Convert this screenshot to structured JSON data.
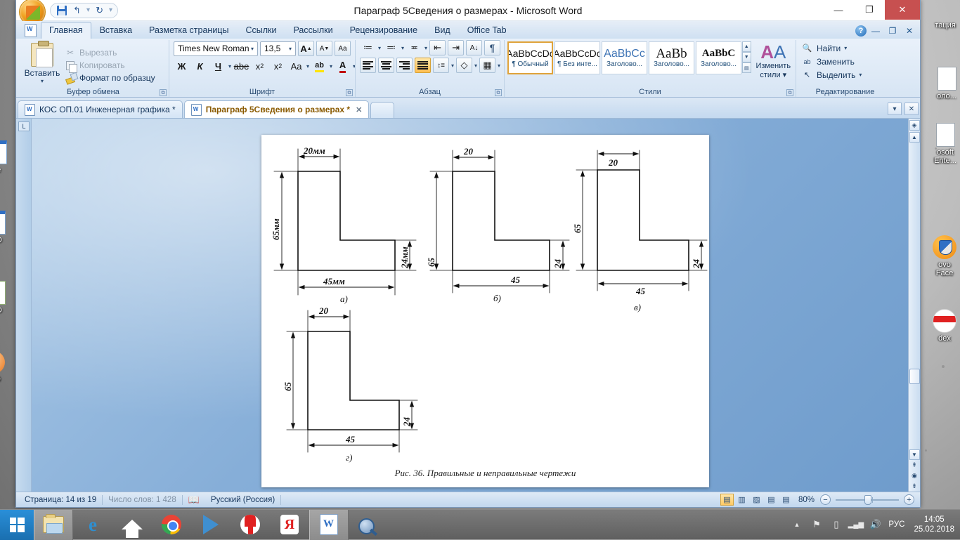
{
  "window": {
    "title": "Параграф 5Сведения о размерах - Microsoft Word",
    "minimize": "—",
    "restore": "❐",
    "close": "✕"
  },
  "quick_access": {
    "save_tip": "save-icon",
    "undo": "↰",
    "undo_caret": "▾",
    "redo": "↻",
    "more": "▾"
  },
  "ribbon": {
    "help": "?",
    "minimize_ribbon": "—",
    "restore_ribbon": "❐",
    "close_ribbon": "✕",
    "tabs": [
      {
        "label": "Главная",
        "active": true
      },
      {
        "label": "Вставка",
        "active": false
      },
      {
        "label": "Разметка страницы",
        "active": false
      },
      {
        "label": "Ссылки",
        "active": false
      },
      {
        "label": "Рассылки",
        "active": false
      },
      {
        "label": "Рецензирование",
        "active": false
      },
      {
        "label": "Вид",
        "active": false
      },
      {
        "label": "Office Tab",
        "active": false
      }
    ],
    "clipboard": {
      "group_label": "Буфер обмена",
      "paste_label": "Вставить",
      "paste_caret": "▾",
      "cut_label": "Вырезать",
      "copy_label": "Копировать",
      "format_painter_label": "Формат по образцу",
      "dialog_launcher": "⧉"
    },
    "font": {
      "group_label": "Шрифт",
      "font_name": "Times New Roman",
      "font_size": "13,5",
      "grow_font": "A",
      "shrink_font": "A",
      "clear_format": "Aa",
      "bold": "Ж",
      "italic": "К",
      "underline": "Ч",
      "underline_caret": "▾",
      "strikethrough": "abe",
      "subscript": "x",
      "subscript_idx": "2",
      "superscript": "x",
      "superscript_idx": "2",
      "change_case": "Aa",
      "change_case_caret": "▾",
      "highlight": "ab",
      "highlight_caret": "▾",
      "font_color": "A",
      "font_color_caret": "▾",
      "dialog_launcher": "⧉"
    },
    "paragraph": {
      "group_label": "Абзац",
      "bullets": "≔",
      "bullets_caret": "▾",
      "numbering": "≕",
      "numbering_caret": "▾",
      "multilevel": "≖",
      "multilevel_caret": "▾",
      "decrease_indent": "⇤",
      "increase_indent": "⇥",
      "sort": "A↓",
      "show_marks": "¶",
      "align_left": "",
      "align_center": "",
      "align_right": "",
      "align_justify": "",
      "line_spacing": "↕≡",
      "line_spacing_caret": "▾",
      "shading": "◇",
      "shading_caret": "▾",
      "borders": "▦",
      "borders_caret": "▾",
      "dialog_launcher": "⧉"
    },
    "styles": {
      "group_label": "Стили",
      "dialog_launcher": "⧉",
      "scroll_up": "▲",
      "scroll_down": "▼",
      "scroll_more": "▤",
      "change_styles_label_1": "Изменить",
      "change_styles_label_2": "стили",
      "change_styles_caret": "▾",
      "items": [
        {
          "preview": "AaBbCcDc",
          "name": "¶ Обычный",
          "selected": true
        },
        {
          "preview": "AaBbCcDc",
          "name": "¶ Без инте...",
          "selected": false
        },
        {
          "preview": "AaBbCc",
          "name": "Заголово...",
          "selected": false
        },
        {
          "preview": "AaBb",
          "name": "Заголово...",
          "selected": false
        },
        {
          "preview": "AaBbC",
          "name": "Заголово...",
          "selected": false
        }
      ]
    },
    "editing": {
      "group_label": "Редактирование",
      "find_label": "Найти",
      "find_caret": "▾",
      "replace_label": "Заменить",
      "select_label": "Выделить",
      "select_caret": "▾"
    }
  },
  "office_tab": {
    "tabs": [
      {
        "label": "КОС ОП.01 Инженерная графика *",
        "active": false,
        "close": ""
      },
      {
        "label": "Параграф 5Сведения о размерах *",
        "active": true,
        "close": "✕"
      }
    ],
    "list_button": "▾",
    "close_button": "✕"
  },
  "document": {
    "caption": "Рис. 36. Правильные и неправильные чертежи",
    "figures": [
      {
        "key": "a",
        "label": "а)",
        "top_dim": "20мм",
        "left_dim": "65мм",
        "right_dim": "24мм",
        "bottom_dim": "45мм"
      },
      {
        "key": "b",
        "label": "б)",
        "top_dim": "20",
        "left_dim": "65",
        "right_dim": "24",
        "bottom_dim": "45"
      },
      {
        "key": "v",
        "label": "в)",
        "top_dim": "20",
        "left_dim": "65",
        "right_dim": "24",
        "bottom_dim": "45"
      },
      {
        "key": "g",
        "label": "г)",
        "top_dim": "20",
        "left_dim": "65",
        "right_dim": "24",
        "bottom_dim": "45"
      }
    ]
  },
  "ruler": {
    "corner_marker": "L"
  },
  "scrollbar": {
    "select_object": "◈",
    "up_arrow": "▲",
    "down_arrow": "▼",
    "prev_page": "⇞",
    "browse_object": "◉",
    "next_page": "⇟"
  },
  "status_bar": {
    "page": "Страница: 14 из 19",
    "words": "Число слов: 1 428",
    "proofing_icon": "spellcheck-icon",
    "language": "Русский (Россия)",
    "views": [
      {
        "name": "print-layout",
        "glyph": "▤",
        "selected": true
      },
      {
        "name": "full-screen-reading",
        "glyph": "▥",
        "selected": false
      },
      {
        "name": "web-layout",
        "glyph": "▨",
        "selected": false
      },
      {
        "name": "outline",
        "glyph": "▤",
        "selected": false
      },
      {
        "name": "draft",
        "glyph": "▤",
        "selected": false
      }
    ],
    "zoom_value": "80%",
    "zoom_out": "−",
    "zoom_in": "+"
  },
  "taskbar": {
    "start": "start-button",
    "apps": [
      {
        "name": "file-explorer",
        "active": true
      },
      {
        "name": "internet-explorer",
        "active": false
      },
      {
        "name": "home-app",
        "active": false
      },
      {
        "name": "google-chrome",
        "active": false
      },
      {
        "name": "media-player",
        "active": false
      },
      {
        "name": "yandex-browser",
        "active": false
      },
      {
        "name": "yandex-app",
        "active": false
      },
      {
        "name": "microsoft-word",
        "active": true
      },
      {
        "name": "search-app",
        "active": false
      }
    ],
    "tray": {
      "show_hidden": "▲",
      "action_center": "⚑",
      "battery": "▯",
      "network": "▂▄▆",
      "volume": "🔊",
      "language": "РУС",
      "time": "14:05",
      "date": "25.02.2018"
    }
  },
  "desktop": {
    "icons": [
      {
        "name": "folder-presentation",
        "label": "тация",
        "type": "folder"
      },
      {
        "name": "folder-kolo",
        "label": "оло...",
        "type": "doc"
      },
      {
        "name": "microsoft-enterprise",
        "label": "osoft\nEnte...",
        "type": "doc2"
      },
      {
        "name": "lenovo-solution-face",
        "label": "ovo\nFace",
        "type": "shield"
      },
      {
        "name": "yandex-disk",
        "label": "dex",
        "type": "ball"
      },
      {
        "name": "left-doc-1",
        "label": "де",
        "type": "blue"
      },
      {
        "name": "left-doc-2",
        "label": "N\nO",
        "type": "blue"
      },
      {
        "name": "left-doc-3",
        "label": "N\nO",
        "type": "green"
      },
      {
        "name": "left-doc-4",
        "label": "N\nO",
        "type": "orange"
      }
    ]
  }
}
